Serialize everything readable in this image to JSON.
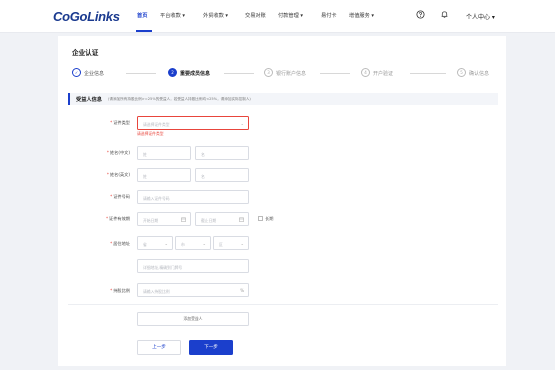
{
  "brand": {
    "logo": "CoGoLinks"
  },
  "nav": [
    {
      "label": "首页"
    },
    {
      "label": "平台收款 ▾"
    },
    {
      "label": "外贸收款 ▾"
    },
    {
      "label": "交易对账"
    },
    {
      "label": "付款管理 ▾"
    },
    {
      "label": "易付卡"
    },
    {
      "label": "增值服务 ▾"
    }
  ],
  "user_menu": "个人中心 ▾",
  "page_title": "企业认证",
  "steps": [
    {
      "num": "✓",
      "label": "企业信息"
    },
    {
      "num": "2",
      "label": "重要成员信息"
    },
    {
      "num": "3",
      "label": "银行账户信息"
    },
    {
      "num": "4",
      "label": "开户验证"
    },
    {
      "num": "5",
      "label": "确认信息"
    }
  ],
  "section": {
    "title": "受益人信息",
    "note": "(请添加所有持股比例>=25%的受益人，若受益人持股比例均<25%，请添加实际控制人)"
  },
  "form": {
    "id_type": {
      "label": "证件类型",
      "placeholder": "请选择证件类型",
      "error": "请选择证件类型"
    },
    "name_cn": {
      "label": "姓名(中文)",
      "ph_last": "姓",
      "ph_first": "名"
    },
    "name_en": {
      "label": "姓名(英文)",
      "ph_last": "姓",
      "ph_first": "名"
    },
    "id_number": {
      "label": "证件号码",
      "placeholder": "请输入证件号码"
    },
    "validity": {
      "label": "证件有效期",
      "start": "开始日期",
      "end": "截止日期",
      "long_term": "长期"
    },
    "address": {
      "label": "居住地址",
      "province": "省",
      "city": "市",
      "district": "区",
      "detail": "详细地址,精确到门牌号"
    },
    "share": {
      "label": "持股比例",
      "placeholder": "请输入持股比例",
      "suffix": "%"
    }
  },
  "add_beneficiary": "添加受益人",
  "buttons": {
    "prev": "上一步",
    "next": "下一步"
  },
  "colors": {
    "primary": "#1b3fcc",
    "error": "#e8453c",
    "background": "#f0f2f6"
  }
}
